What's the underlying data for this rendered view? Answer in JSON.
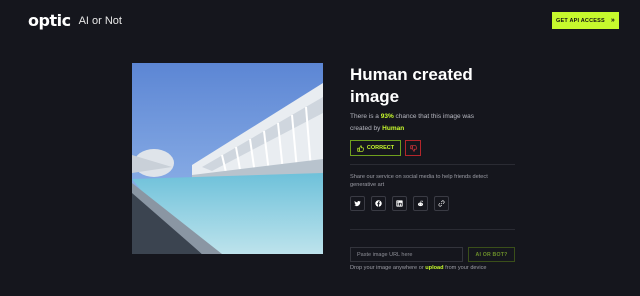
{
  "header": {
    "logo_text": "optic",
    "logo_sub": "AI or Not",
    "api_button": "GET API ACCESS",
    "api_button_icon": "double-chevron-right-icon"
  },
  "result": {
    "title": "Human created image",
    "desc_pre": "There is a ",
    "percent": "93%",
    "desc_mid": " chance that this image was created by ",
    "verdict": "Human",
    "correct_label": "CORRECT",
    "correct_icon": "thumbs-up-icon",
    "dislike_icon": "thumbs-down-icon"
  },
  "share": {
    "text": "Share our service on social media to help friends detect generative art",
    "icons": [
      "twitter-icon",
      "facebook-icon",
      "linkedin-icon",
      "reddit-icon",
      "link-icon"
    ]
  },
  "upload": {
    "placeholder": "Paste image URL here",
    "button": "AI OR BOT?",
    "drop_pre": "Drop your image anywhere or ",
    "drop_link": "upload",
    "drop_post": " from your device"
  },
  "colors": {
    "background": "#15161d",
    "accent": "#c6f92d",
    "danger": "#e0353b"
  }
}
